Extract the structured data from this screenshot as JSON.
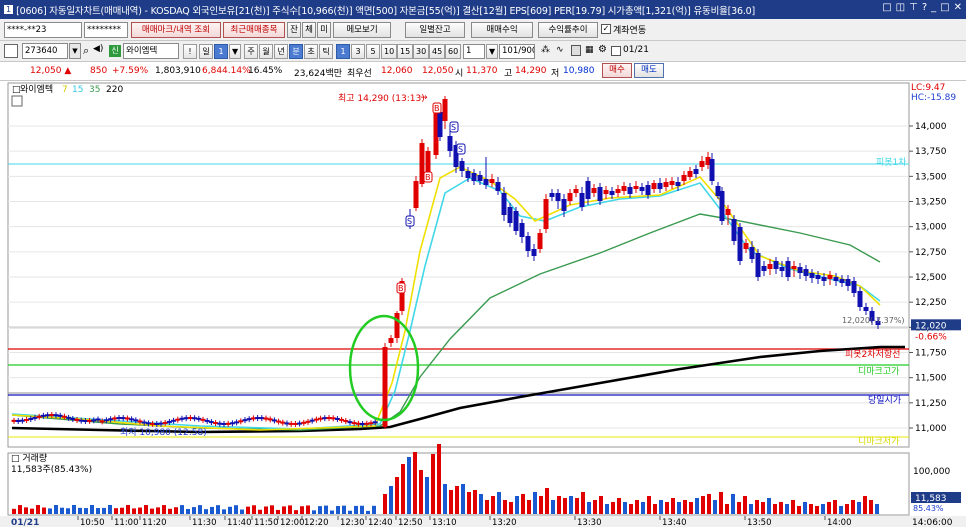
{
  "window": {
    "title": "[0606] 자동일자차트(매매내역) - KOSDAQ 외국인보유[21(천)] 주식수[10,966(천)] 액면[500] 자본금[55(억)] 결산[12월] EPS[609] PER[19.79] 시가총액[1,321(억)] 유동비율[36.0]",
    "index": "1"
  },
  "toolbar1": {
    "account": "****-**23",
    "password": "********",
    "buttons": [
      "매매마크/내역 조회",
      "최근매매종목",
      "잔",
      "체",
      "미",
      "메모보기",
      "일별잔고",
      "매매수익",
      "수익률추이"
    ],
    "check_label": "계좌연동"
  },
  "toolbar2": {
    "code": "273640",
    "name": "와이엠텍",
    "mode": "일",
    "unit": "1",
    "periods": [
      "주",
      "월",
      "년",
      "분",
      "초",
      "틱"
    ],
    "minutes": [
      "1",
      "3",
      "5",
      "10",
      "15",
      "30",
      "45",
      "60"
    ],
    "count": "1",
    "range": "101/900",
    "date": "01/21"
  },
  "quote": {
    "price": "12,050",
    "change": "850",
    "pct": "+7.59%",
    "volume": "1,803,910",
    "vol_ratio": "6,844.14%",
    "turnover": "16.45%",
    "amount": "23,624백만",
    "bid_label": "최우선",
    "bid": "12,060",
    "ask": "12,050",
    "open_label": "시",
    "open": "11,370",
    "high_label": "고",
    "high": "14,290",
    "low_label": "저",
    "low": "10,980",
    "buy": "매수",
    "sell": "매도"
  },
  "legend": {
    "name": "와이엠텍",
    "ma": [
      "7",
      "15",
      "35",
      "220"
    ],
    "ma_colors": [
      "#f0e000",
      "#40d8f0",
      "#3a9a50",
      "#000000"
    ]
  },
  "price_axis": {
    "ticks": [
      "14,000",
      "13,750",
      "13,500",
      "13,250",
      "13,000",
      "12,750",
      "12,500",
      "12,250",
      "12,000",
      "11,750",
      "11,500",
      "11,250",
      "11,000"
    ],
    "lc": "LC:9.47",
    "hc": "HC:-15.89",
    "current_box": "12,020",
    "current_pct": "-0.66%"
  },
  "annotations": {
    "high": "최고 14,290 (13:13)",
    "low": "최저 10,980 (12:58)",
    "current": "12,020(-7.37%)",
    "lines": [
      "피봇2차저항선",
      "디마크고가",
      "당일시가",
      "디마크저가",
      "피봇1차"
    ]
  },
  "volume": {
    "title": "거래량",
    "value": "11,583주(85.43%)",
    "axis": "100,000",
    "box": "11,583",
    "box_pct": "85.43%"
  },
  "time_axis": {
    "date": "01/21",
    "labels": [
      "10:50",
      "11:00",
      "11:20",
      "11:30",
      "11:40",
      "11:50",
      "12:00",
      "12:20",
      "12:30",
      "12:40",
      "12:50",
      "13:10",
      "13:20",
      "13:30",
      "13:40",
      "13:50",
      "14:00"
    ],
    "end": "14:06:00"
  },
  "chart_data": {
    "type": "candlestick",
    "open": 11370,
    "high": 14290,
    "low": 10980,
    "close": 12050,
    "ylim": [
      10900,
      14300
    ]
  }
}
